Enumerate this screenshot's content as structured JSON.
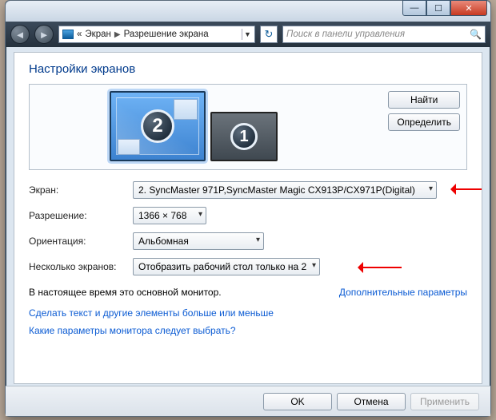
{
  "titlebar": {
    "minimize": "—",
    "maximize": "☐",
    "close": "✕"
  },
  "addressbar": {
    "back": "◄",
    "forward": "►",
    "segments": [
      "«",
      "Экран",
      "Разрешение экрана"
    ],
    "refresh": "↻",
    "search_placeholder": "Поиск в панели управления"
  },
  "page_title": "Настройки экранов",
  "preview": {
    "monitor2_num": "2",
    "monitor1_num": "1",
    "detect_btn": "Найти",
    "identify_btn": "Определить"
  },
  "form": {
    "display_lbl": "Экран:",
    "display_val": "2. SyncMaster 971P,SyncMaster Magic CX913P/CX971P(Digital)",
    "resolution_lbl": "Разрешение:",
    "resolution_val": "1366 × 768",
    "orientation_lbl": "Ориентация:",
    "orientation_val": "Альбомная",
    "multi_lbl": "Несколько экранов:",
    "multi_val": "Отобразить рабочий стол только на 2"
  },
  "status_text": "В настоящее время это основной монитор.",
  "adv_link": "Дополнительные параметры",
  "link1": "Сделать текст и другие элементы больше или меньше",
  "link2": "Какие параметры монитора следует выбрать?",
  "footer": {
    "ok": "OK",
    "cancel": "Отмена",
    "apply": "Применить"
  }
}
